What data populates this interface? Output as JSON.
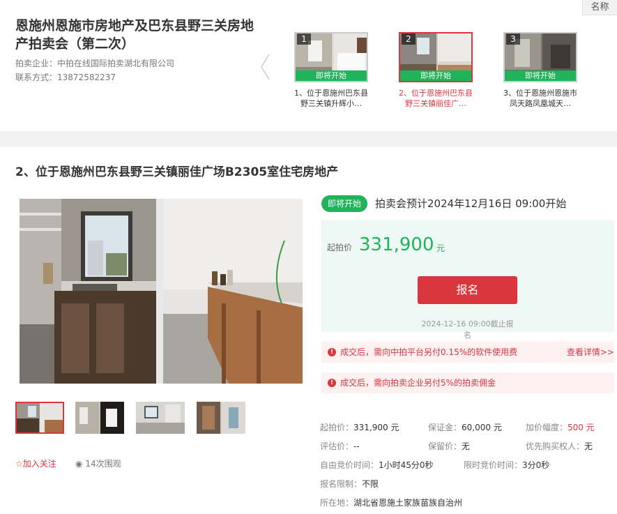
{
  "header": {
    "name_tab": "名称",
    "title": "恩施州恩施市房地产及巴东县野三关房地产拍卖会（第二次）",
    "company_label": "拍卖企业：",
    "company": "中拍在线国际拍卖湖北有限公司",
    "contact_label": "联系方式：",
    "contact": "13872582237"
  },
  "lots": [
    {
      "num": "1",
      "status": "即将开始",
      "caption": "1、位于恩施州巴东县野三关镇升辉小…"
    },
    {
      "num": "2",
      "status": "即将开始",
      "caption": "2、位于恩施州巴东县野三关镇丽佳广…"
    },
    {
      "num": "3",
      "status": "即将开始",
      "caption": "3、位于恩施州恩施市凤天路凤凰城天…"
    }
  ],
  "item": {
    "title": "2、位于恩施州巴东县野三关镇丽佳广场B2305室住宅房地产",
    "follow": "加入关注",
    "views": "14次围观"
  },
  "auction": {
    "badge": "即将开始",
    "schedule": "拍卖会预计2024年12月16日  09:00开始",
    "start_price_label": "起拍价",
    "start_price": "331,900",
    "price_unit": "元",
    "signup": "报名",
    "deadline": "2024-12-16 09:00截止报名"
  },
  "notices": [
    {
      "text": "成交后，需向中拍平台另付0.15%的软件使用费",
      "more": "查看详情>>"
    },
    {
      "text": "成交后，需向拍卖企业另付5%的拍卖佣金",
      "more": ""
    }
  ],
  "details": {
    "start_price": {
      "label": "起拍价：",
      "value": "331,900 元"
    },
    "deposit": {
      "label": "保证金：",
      "value": "60,000 元"
    },
    "increment": {
      "label": "加价幅度：",
      "value": "500 元"
    },
    "appraisal": {
      "label": "评估价：",
      "value": "--"
    },
    "reserve": {
      "label": "保留价：",
      "value": "无"
    },
    "priority": {
      "label": "优先购买权人：",
      "value": "无"
    },
    "free_time": {
      "label": "自由竞价时间：",
      "value": "1小时45分0秒"
    },
    "limit_time": {
      "label": "限时竞价时间：",
      "value": "3分0秒"
    },
    "restriction": {
      "label": "报名限制：",
      "value": "不限"
    },
    "location": {
      "label": "所在地：",
      "value": "湖北省恩施土家族苗族自治州"
    }
  }
}
